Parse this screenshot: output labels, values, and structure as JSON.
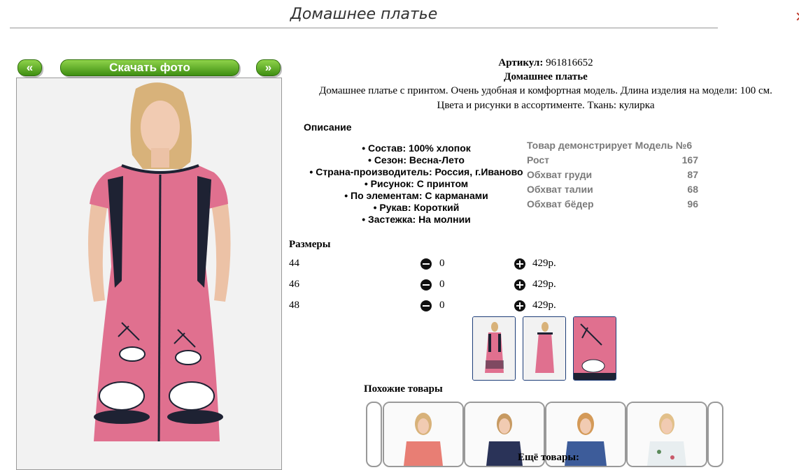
{
  "page": {
    "title": "Домашнее платье",
    "close_icon": "close-icon"
  },
  "nav": {
    "prev_label": "«",
    "download_label": "Скачать фото",
    "next_label": "»"
  },
  "product": {
    "article_label": "Артикул:",
    "article_value": "961816652",
    "name": "Домашнее платье",
    "description_line1": "Домашнее платье с принтом. Очень удобная и комфортная модель. Длина изделия на модели: 100 см.",
    "description_line2": "Цвета и рисунки в ассортименте. Ткань: кулирка"
  },
  "description": {
    "title": "Описание",
    "features": [
      "• Состав: 100% хлопок",
      "• Сезон: Весна-Лето",
      "• Страна-производитель: Россия, г.Иваново",
      "• Рисунок: С принтом",
      "• По элементам: С карманами",
      "• Рукав: Короткий",
      "• Застежка: На молнии"
    ]
  },
  "model_params": {
    "title": "Товар демонстрирует Модель №6",
    "rows": [
      {
        "label": "Рост",
        "value": "167"
      },
      {
        "label": "Обхват груди",
        "value": "87"
      },
      {
        "label": "Обхват талии",
        "value": "68"
      },
      {
        "label": "Обхват бёдер",
        "value": "96"
      }
    ]
  },
  "sizes": {
    "title": "Размеры",
    "rows": [
      {
        "size": "44",
        "qty": "0",
        "price": "429р."
      },
      {
        "size": "46",
        "qty": "0",
        "price": "429р."
      },
      {
        "size": "48",
        "qty": "0",
        "price": "429р."
      }
    ]
  },
  "similar": {
    "title": "Похожие товары"
  },
  "more": {
    "title": "Ещё товары:"
  },
  "colors": {
    "accent_green": "#5aa81e",
    "thumb_border": "#1d3d78",
    "dress_pink": "#e0708f"
  }
}
